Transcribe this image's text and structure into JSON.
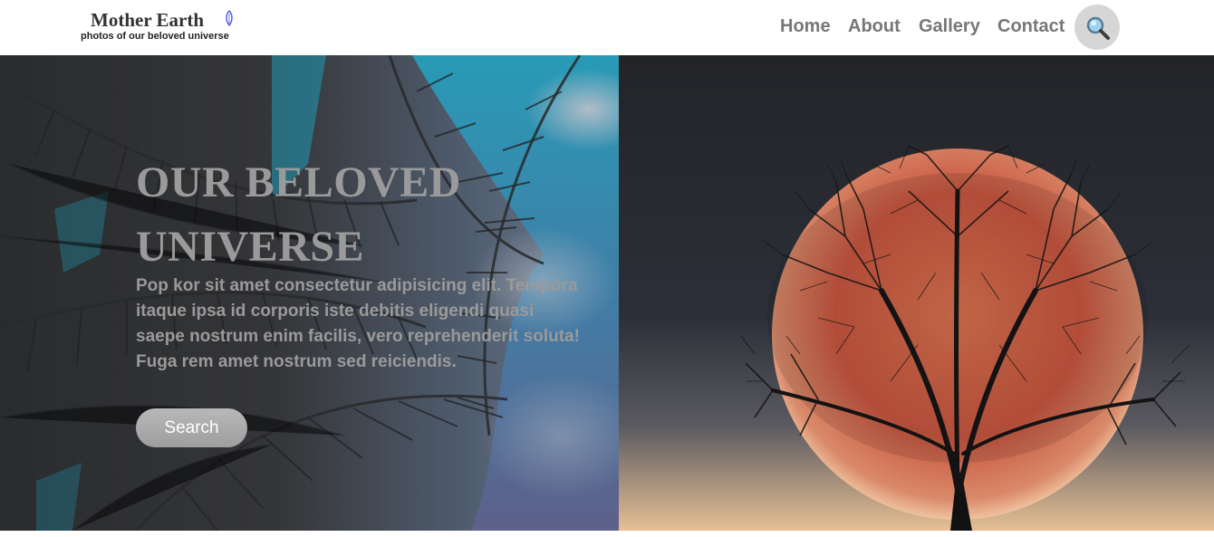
{
  "header": {
    "logo_title": "Mother Earth",
    "logo_subtitle": "photos of our beloved universe",
    "nav": [
      "Home",
      "About",
      "Gallery",
      "Contact"
    ],
    "search_icon": "magnifying-glass-icon"
  },
  "hero": {
    "title": "OUR BELOVED UNIVERSE",
    "body": "Pop kor sit amet consectetur adipisicing elit. Tempora itaque ipsa id corporis iste debitis eligendi quasi saepe nostrum enim facilis, vero reprehenderit soluta! Fuga rem amet nostrum sed reiciendis.",
    "search_button": "Search"
  },
  "images": {
    "left": "palm-leaves-against-blue-sky-photo",
    "right": "bare-tree-silhouette-before-red-moon-photo"
  },
  "colors": {
    "nav_text": "#777777",
    "hero_text": "#9a9a9a",
    "search_circle": "#d6d6d6",
    "moon": "#c8553e",
    "sky_accent": "#1fb6d8"
  }
}
